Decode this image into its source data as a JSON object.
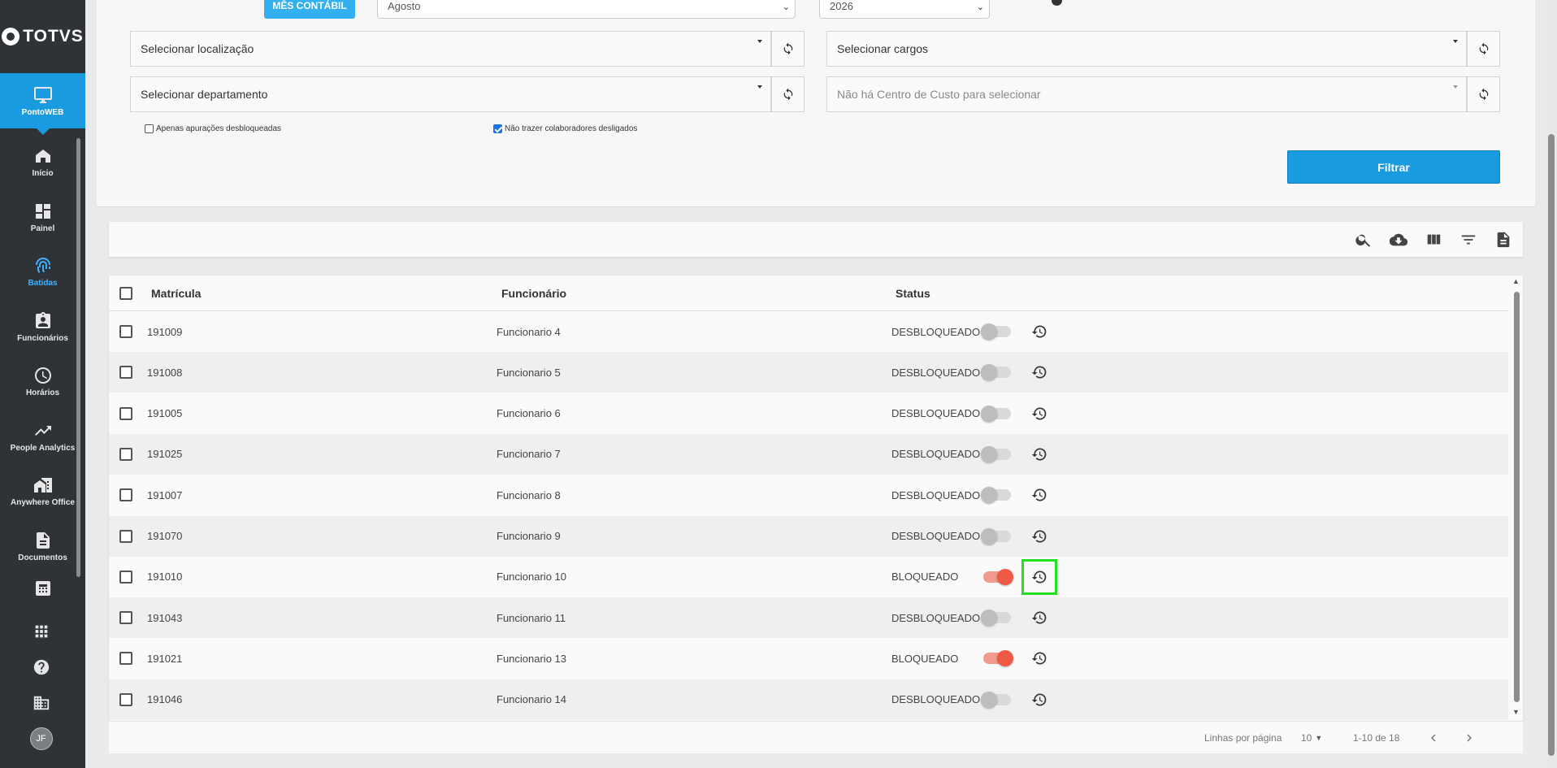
{
  "brand": {
    "name": "TOTVS",
    "app": "PontoWEB"
  },
  "sidebar": {
    "items": [
      {
        "label": "Início",
        "icon": "home-icon"
      },
      {
        "label": "Painel",
        "icon": "dashboard-icon"
      },
      {
        "label": "Batidas",
        "icon": "fingerprint-icon",
        "selected": true
      },
      {
        "label": "Funcionários",
        "icon": "badge-icon"
      },
      {
        "label": "Horários",
        "icon": "clock-icon"
      },
      {
        "label": "People Analytics",
        "icon": "trending-up-icon"
      },
      {
        "label": "Anywhere Office",
        "icon": "home-work-icon"
      },
      {
        "label": "Documentos",
        "icon": "document-icon"
      }
    ],
    "avatar_initials": "JF"
  },
  "filters": {
    "mes_contabil_label": "MÊS CONTÁBIL",
    "month_value": "Agosto",
    "year_value": "2026",
    "localizacao_placeholder": "Selecionar localização",
    "cargos_placeholder": "Selecionar cargos",
    "departamento_placeholder": "Selecionar departamento",
    "centro_custo_placeholder": "Não há Centro de Custo para selecionar",
    "only_unlocked_label": "Apenas apurações desbloqueadas",
    "exclude_dismissed_label": "Não trazer colaboradores desligados",
    "filter_button": "Filtrar"
  },
  "table": {
    "headers": {
      "matricula": "Matrícula",
      "funcionario": "Funcionário",
      "status": "Status"
    },
    "rows": [
      {
        "matricula": "191009",
        "funcionario": "Funcionario 4",
        "status": "DESBLOQUEADO",
        "locked": false
      },
      {
        "matricula": "191008",
        "funcionario": "Funcionario 5",
        "status": "DESBLOQUEADO",
        "locked": false
      },
      {
        "matricula": "191005",
        "funcionario": "Funcionario 6",
        "status": "DESBLOQUEADO",
        "locked": false
      },
      {
        "matricula": "191025",
        "funcionario": "Funcionario 7",
        "status": "DESBLOQUEADO",
        "locked": false
      },
      {
        "matricula": "191007",
        "funcionario": "Funcionario 8",
        "status": "DESBLOQUEADO",
        "locked": false
      },
      {
        "matricula": "191070",
        "funcionario": "Funcionario 9",
        "status": "DESBLOQUEADO",
        "locked": false
      },
      {
        "matricula": "191010",
        "funcionario": "Funcionario 10",
        "status": "BLOQUEADO",
        "locked": true,
        "highlighted": true
      },
      {
        "matricula": "191043",
        "funcionario": "Funcionario 11",
        "status": "DESBLOQUEADO",
        "locked": false
      },
      {
        "matricula": "191021",
        "funcionario": "Funcionario 13",
        "status": "BLOQUEADO",
        "locked": true
      },
      {
        "matricula": "191046",
        "funcionario": "Funcionario 14",
        "status": "DESBLOQUEADO",
        "locked": false
      }
    ]
  },
  "pagination": {
    "rows_per_page_label": "Linhas por página",
    "rows_per_page_value": "10",
    "range": "1-10 de 18"
  },
  "colors": {
    "primary": "#1a9be0",
    "sidebar": "#2f3338",
    "toggle_on": "#ef5a45",
    "highlight": "#22e022"
  }
}
